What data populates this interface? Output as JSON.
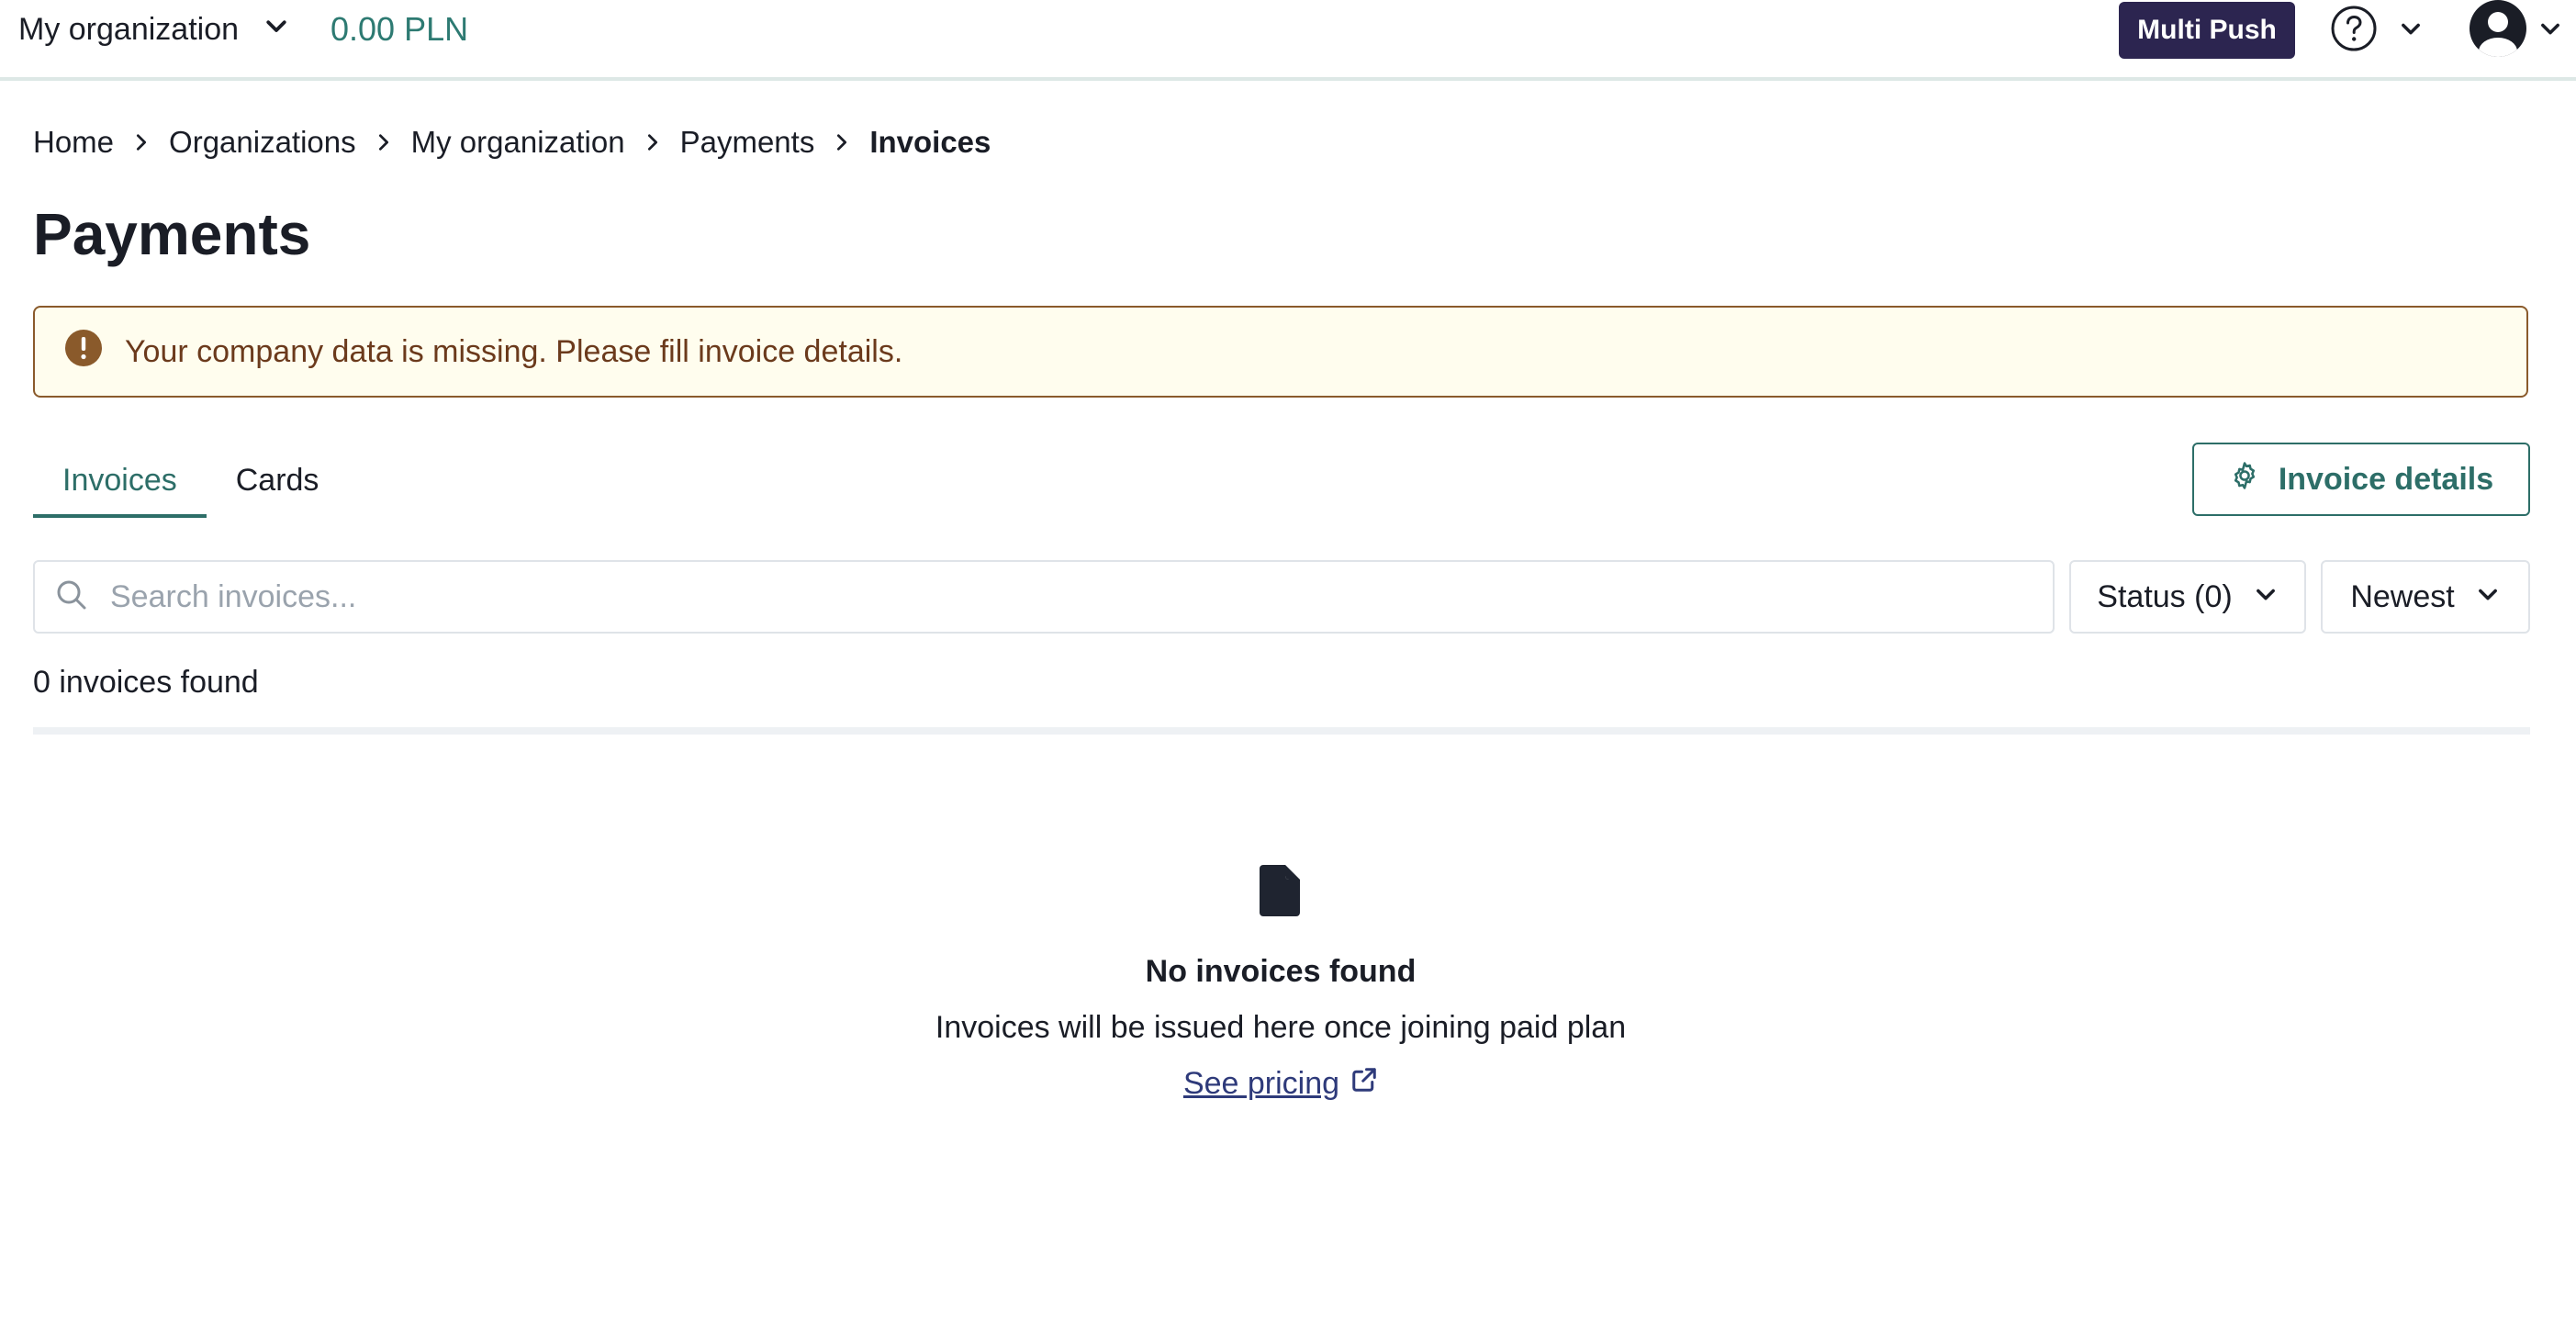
{
  "header": {
    "org_name": "My organization",
    "balance": "0.00 PLN",
    "multi_push_label": "Multi Push",
    "icons": {
      "org_chevron": "chevron-down-icon",
      "help": "help-circle-icon",
      "help_chevron": "chevron-down-icon",
      "avatar": "user-avatar-icon",
      "avatar_chevron": "chevron-down-icon"
    }
  },
  "breadcrumb": {
    "items": [
      "Home",
      "Organizations",
      "My organization",
      "Payments"
    ],
    "current": "Invoices"
  },
  "page": {
    "title": "Payments"
  },
  "alert": {
    "icon": "exclamation-circle-icon",
    "message": "Your company data is missing. Please fill invoice details."
  },
  "tabs": [
    {
      "label": "Invoices",
      "active": true
    },
    {
      "label": "Cards",
      "active": false
    }
  ],
  "toolbar": {
    "invoice_details_label": "Invoice details",
    "search_placeholder": "Search invoices...",
    "search_value": "",
    "status_filter_label": "Status (0)",
    "sort_label": "Newest"
  },
  "results": {
    "count_text": "0 invoices found"
  },
  "empty_state": {
    "icon": "document-icon",
    "title": "No invoices found",
    "subtitle": "Invoices will be issued here once joining paid plan",
    "link_label": "See pricing",
    "link_icon": "external-link-icon"
  },
  "colors": {
    "accent": "#2d6e68",
    "balance": "#2d7a72",
    "multi_push_bg": "#2c2550",
    "alert_bg": "#fffdee",
    "alert_border": "#8a5a2b",
    "alert_text": "#6b3a1c",
    "link": "#2e3a7a"
  }
}
